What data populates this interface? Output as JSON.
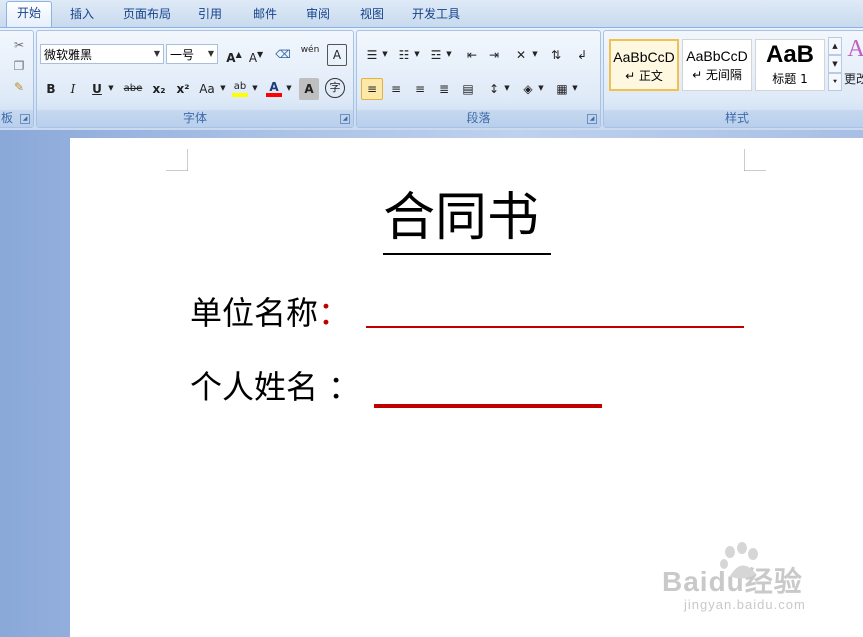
{
  "tabs": [
    "开始",
    "插入",
    "页面布局",
    "引用",
    "邮件",
    "审阅",
    "视图",
    "开发工具"
  ],
  "clipboard": {
    "label": "板"
  },
  "font": {
    "group_label": "字体",
    "font_name": "微软雅黑",
    "font_size": "一号",
    "grow_label": "A",
    "shrink_label": "A",
    "phonetic_label": "wén",
    "border_char_label": "A",
    "bold_label": "B",
    "italic_label": "I",
    "underline_label": "U",
    "strike_label": "abe",
    "subscript_label": "x₂",
    "superscript_label": "x²",
    "case_label": "Aa",
    "highlight_label": "ab",
    "fontcolor_label": "A",
    "shading_label": "A",
    "enclose_label": "字"
  },
  "paragraph": {
    "group_label": "段落"
  },
  "styles": {
    "group_label": "样式",
    "items": [
      {
        "sample": "AaBbCcD",
        "name": "↵ 正文"
      },
      {
        "sample": "AaBbCcD",
        "name": "↵ 无间隔"
      },
      {
        "sample": "AaB",
        "name": "标题 1"
      }
    ],
    "change_label": "更改"
  },
  "document": {
    "title": "合同书",
    "field1_label": "单位名称",
    "field1_colon": "：",
    "field2_label": "个人姓名 ：",
    "underline_color": "#c00000"
  },
  "watermark": {
    "brand": "Baidu经验",
    "url": "jingyan.baidu.com"
  },
  "colors": {
    "ribbon": "#dbe7f6",
    "tab_text": "#15428b",
    "highlight_bar": "#ffff00",
    "fontcolor_bar": "#ff0000"
  }
}
